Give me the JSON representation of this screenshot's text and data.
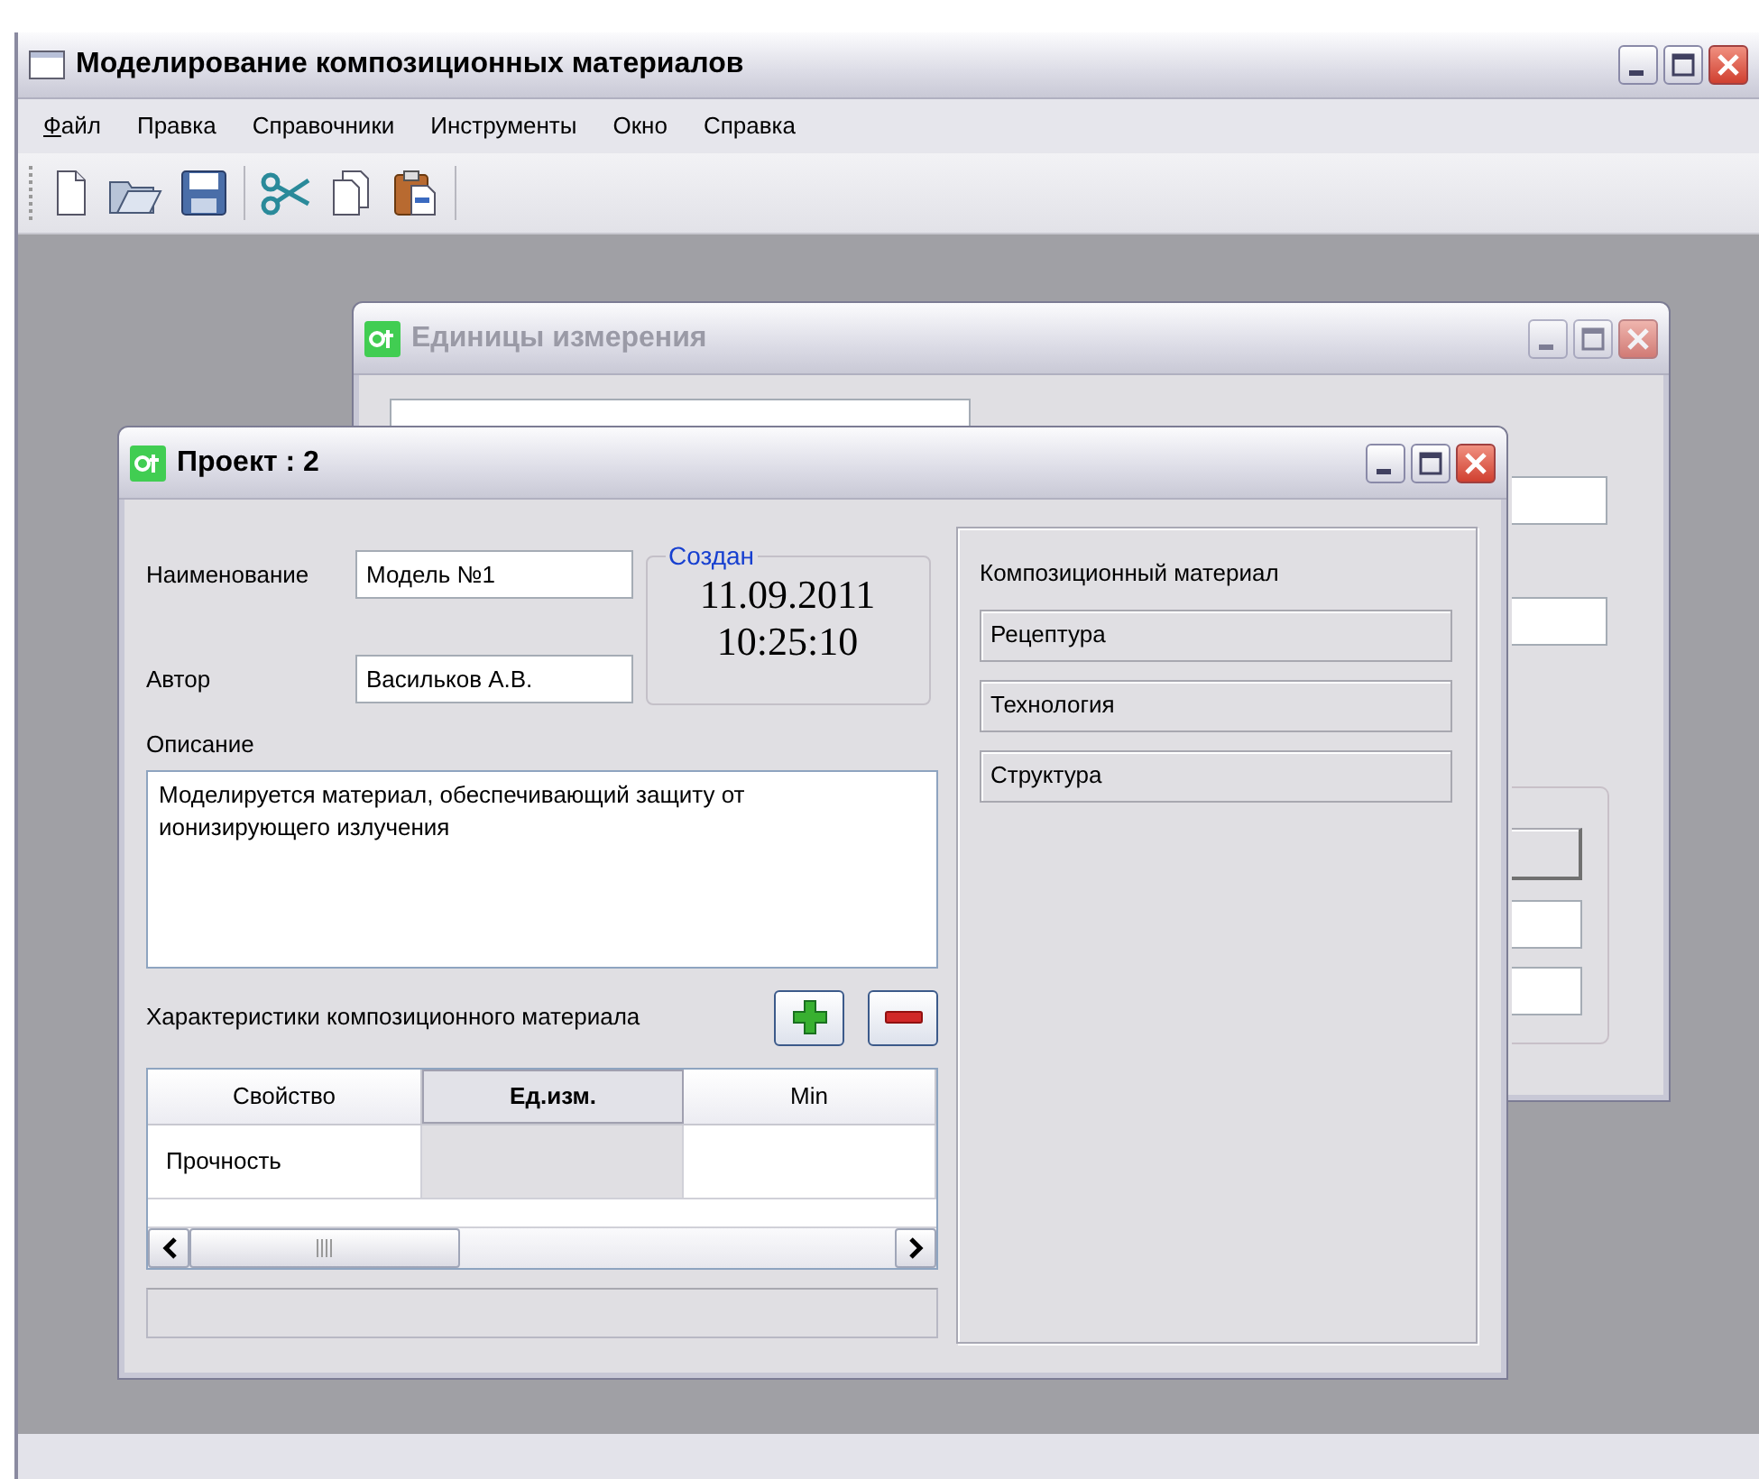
{
  "main_window": {
    "title": "Моделирование композиционных материалов",
    "active": true
  },
  "menu": [
    {
      "label": "Файл",
      "mnemonic": true
    },
    {
      "label": "Правка",
      "mnemonic": false
    },
    {
      "label": "Справочники",
      "mnemonic": false
    },
    {
      "label": "Инструменты",
      "mnemonic": false
    },
    {
      "label": "Окно",
      "mnemonic": false
    },
    {
      "label": "Справка",
      "mnemonic": false
    }
  ],
  "back_window": {
    "title": "Единицы измерения",
    "active": false
  },
  "project_window": {
    "title": "Проект : 2",
    "active": true,
    "name": {
      "label": "Наименование",
      "value": "Модель №1"
    },
    "author": {
      "label": "Автор",
      "value": "Васильков А.В."
    },
    "created": {
      "title": "Создан",
      "date": "11.09.2011",
      "time": "10:25:10"
    },
    "description": {
      "label": "Описание",
      "value": "Моделируется материал, обеспечивающий защиту от ионизирующего излучения"
    },
    "characteristics": {
      "label": "Характеристики композиционного материала",
      "columns": [
        {
          "label": "Свойство",
          "selected": false
        },
        {
          "label": "Ед.изм.",
          "selected": true
        },
        {
          "label": "Min",
          "selected": false
        }
      ],
      "rows": [
        {
          "property": "Прочность"
        }
      ]
    },
    "material": {
      "title": "Композиционный материал",
      "buttons": [
        "Рецептура",
        "Технология",
        "Структура"
      ]
    }
  }
}
